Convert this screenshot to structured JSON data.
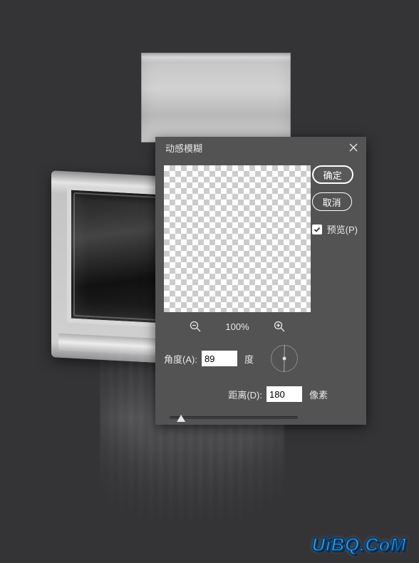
{
  "background": {
    "color": "#343437"
  },
  "dialog": {
    "title": "动感模糊",
    "close_icon": "close",
    "buttons": {
      "ok": "确定",
      "cancel": "取消"
    },
    "preview_checkbox": {
      "checked": true,
      "label": "预览(P)"
    },
    "zoom": {
      "out_icon": "zoom-out",
      "in_icon": "zoom-in",
      "value": "100%"
    },
    "angle": {
      "label": "角度(A):",
      "value": "89",
      "unit": "度"
    },
    "distance": {
      "label": "距离(D):",
      "value": "180",
      "unit": "像素",
      "min": 1,
      "max": 2000
    }
  },
  "watermark": "UiBQ.CoM"
}
